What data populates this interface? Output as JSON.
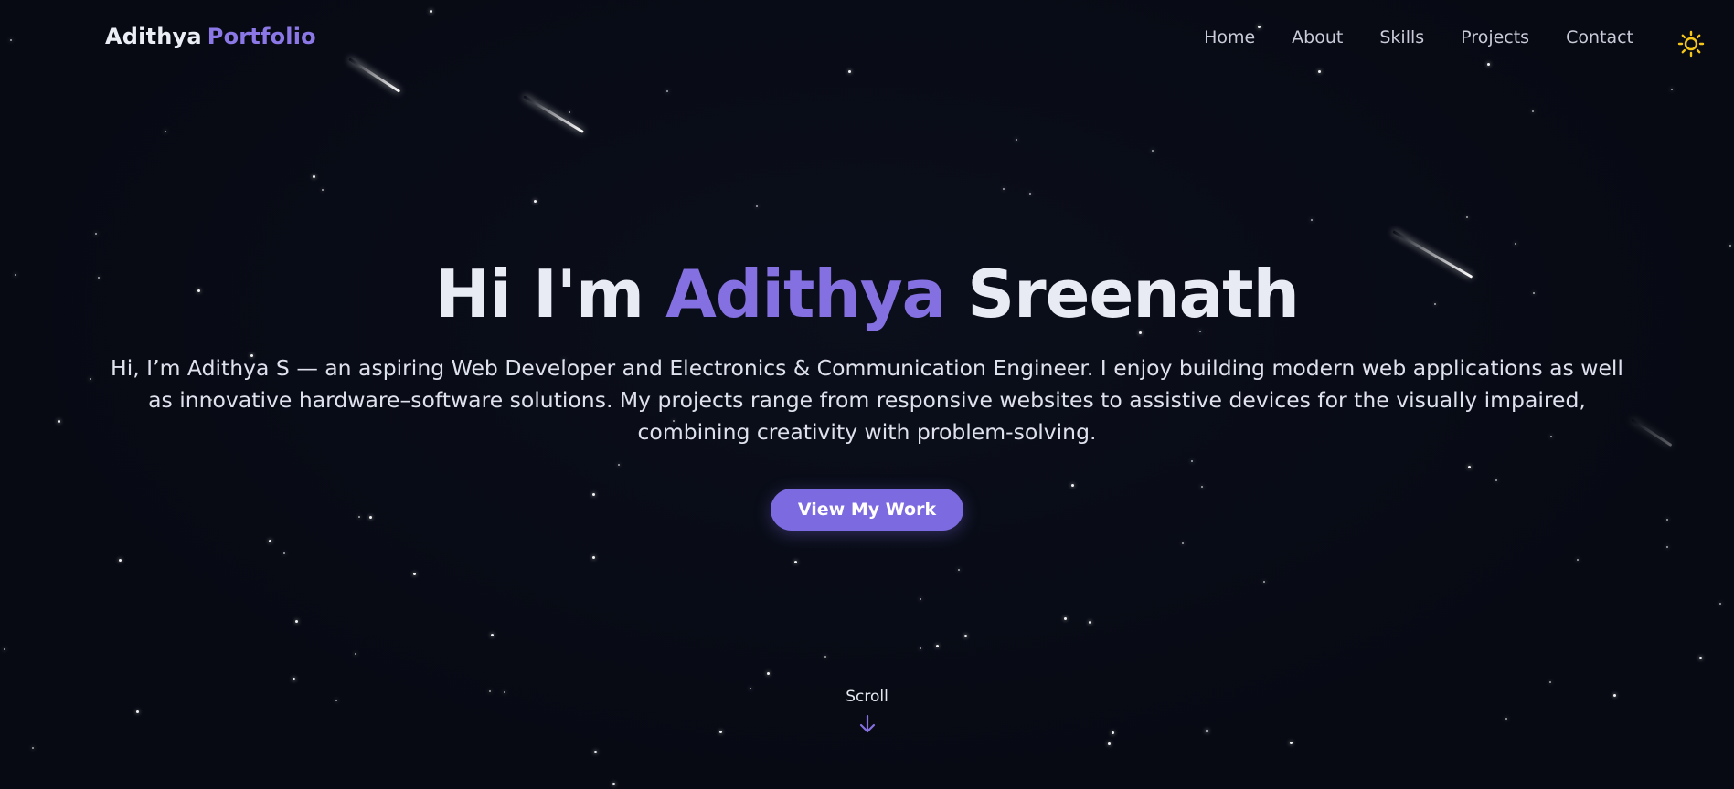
{
  "brand": {
    "first": "Adithya",
    "second": "Portfolio"
  },
  "nav": {
    "items": [
      "Home",
      "About",
      "Skills",
      "Projects",
      "Contact"
    ],
    "theme_toggle_icon": "sun-icon"
  },
  "hero": {
    "title_prefix": "Hi I'm",
    "title_accent": "Adithya",
    "title_suffix": "Sreenath",
    "description": "Hi, I’m Adithya S — an aspiring Web Developer and Electronics & Communication Engineer. I enjoy building modern web applications as well as innovative hardware–software solutions. My projects range from responsive websites to assistive devices for the visually impaired, combining creativity with problem-solving.",
    "cta_label": "View My Work"
  },
  "scroll": {
    "label": "Scroll",
    "icon": "arrow-down-icon"
  },
  "colors": {
    "background": "#070a13",
    "accent": "#8470e0",
    "button": "#7c6ae0",
    "sun": "#f5c518"
  }
}
